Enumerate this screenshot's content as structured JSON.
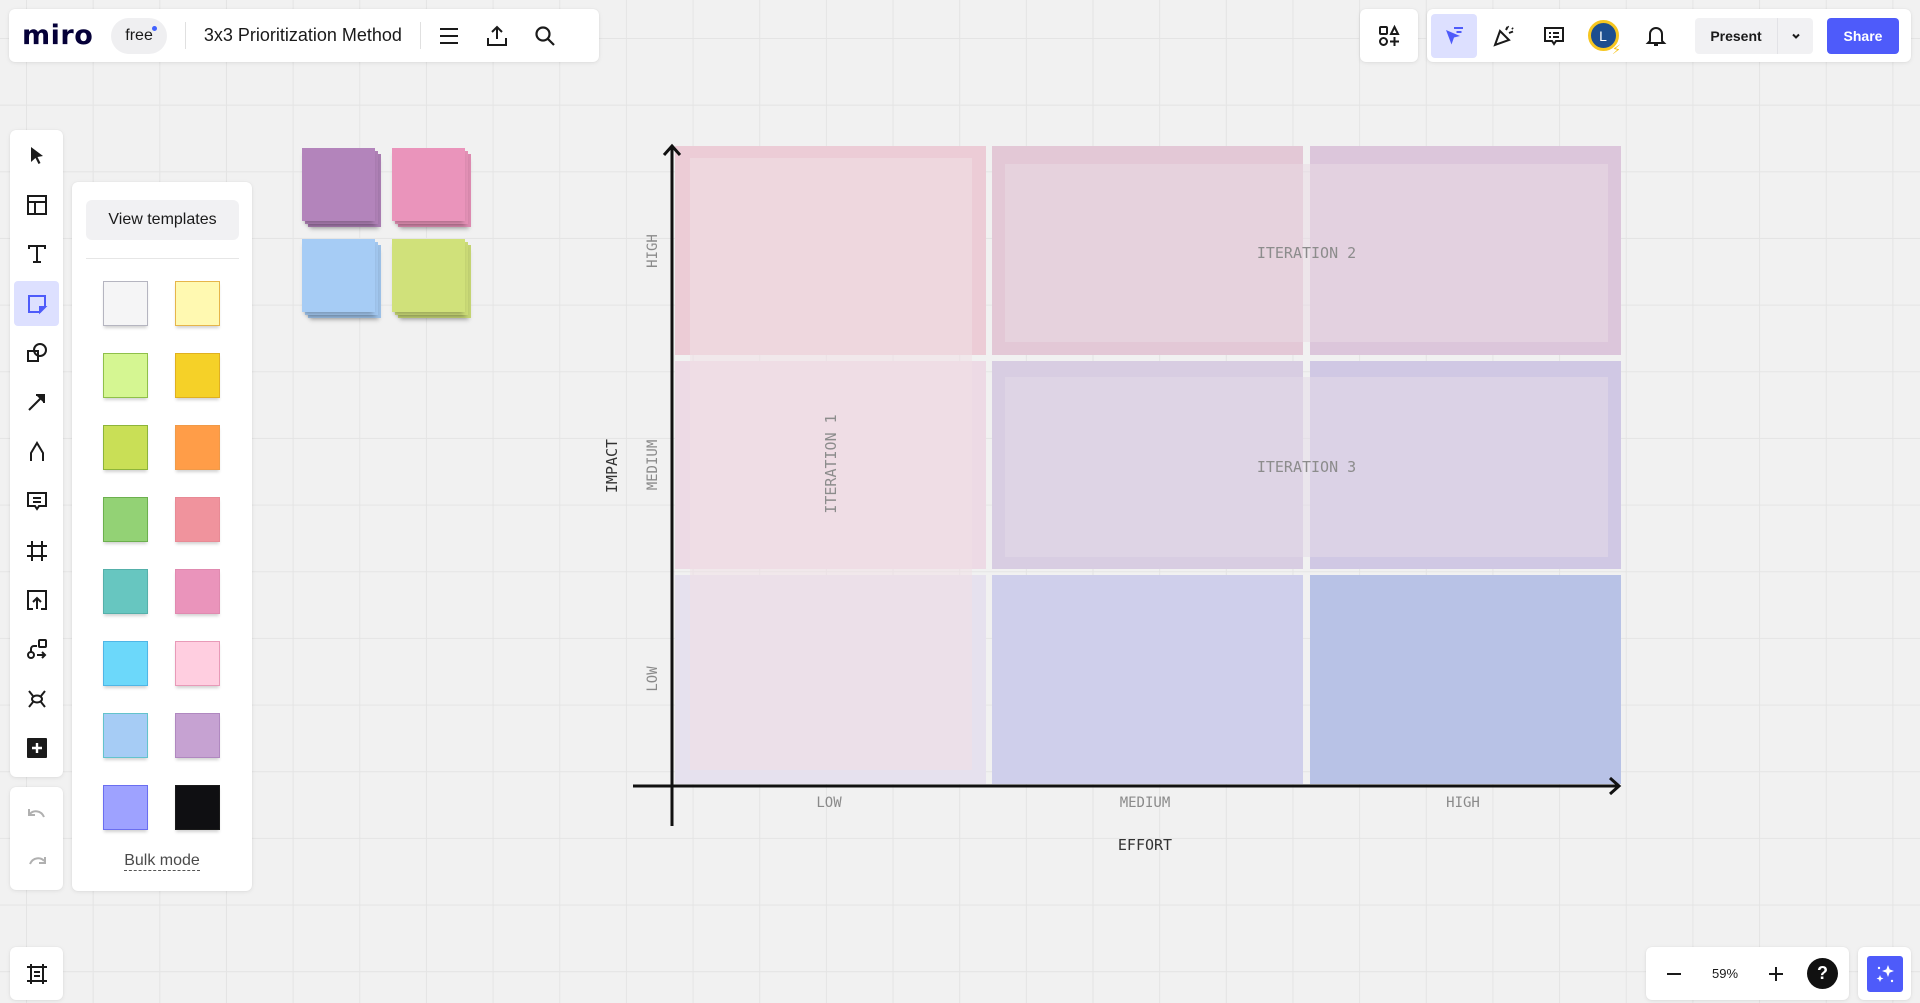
{
  "app": {
    "logo": "miro",
    "plan_badge": "free",
    "board_title": "3x3 Prioritization Method"
  },
  "top_bar_icons": [
    "menu-icon",
    "export-icon",
    "search-icon"
  ],
  "collab_bar": {
    "icons": [
      "apps-icon",
      "follow-cursor-icon",
      "celebrate-icon",
      "comments-icon",
      "avatar",
      "notifications-icon"
    ],
    "avatar_initial": "L",
    "present_label": "Present",
    "share_label": "Share",
    "accent_color": "#4e5bfa"
  },
  "left_toolbar": {
    "tools": [
      {
        "name": "select",
        "icon": "cursor-icon",
        "active": false
      },
      {
        "name": "templates",
        "icon": "layout-icon",
        "active": false
      },
      {
        "name": "text",
        "icon": "text-icon",
        "active": false
      },
      {
        "name": "sticky-note",
        "icon": "sticky-note-icon",
        "active": true
      },
      {
        "name": "shapes",
        "icon": "shapes-icon",
        "active": false
      },
      {
        "name": "connection-line",
        "icon": "arrow-icon",
        "active": false
      },
      {
        "name": "pen",
        "icon": "pen-icon",
        "active": false
      },
      {
        "name": "comment",
        "icon": "comment-icon",
        "active": false
      },
      {
        "name": "frame",
        "icon": "frame-icon",
        "active": false
      },
      {
        "name": "upload",
        "icon": "upload-icon",
        "active": false
      },
      {
        "name": "diagram",
        "icon": "diagram-icon",
        "active": false
      },
      {
        "name": "mind-map",
        "icon": "mindmap-icon",
        "active": false
      },
      {
        "name": "more-apps",
        "icon": "plus-square-icon",
        "active": false
      }
    ],
    "undo_icon": "undo-icon",
    "redo_icon": "redo-icon",
    "frames_icon": "frames-list-icon"
  },
  "sticky_panel": {
    "view_templates_label": "View templates",
    "bulk_mode_label": "Bulk mode",
    "swatches": [
      {
        "color": "#f5f5f6",
        "border": "#b5b5c0"
      },
      {
        "color": "#fff9b1",
        "border": "#e6b54a"
      },
      {
        "color": "#d5f692",
        "border": "#8fc04a"
      },
      {
        "color": "#f5d128",
        "border": "#e0b020"
      },
      {
        "color": "#c9df56",
        "border": "#8db43a"
      },
      {
        "color": "#ff9d48",
        "border": "#f09a48"
      },
      {
        "color": "#93d275",
        "border": "#6cb04e"
      },
      {
        "color": "#f0939d",
        "border": "#e88a95"
      },
      {
        "color": "#67c6c0",
        "border": "#55b0aa"
      },
      {
        "color": "#ea94bb",
        "border": "#e08ab0"
      },
      {
        "color": "#6cd8fa",
        "border": "#4fb6e6"
      },
      {
        "color": "#ffcee0",
        "border": "#e89ab8"
      },
      {
        "color": "#a6ccf5",
        "border": "#63c3cc"
      },
      {
        "color": "#c6a2d2",
        "border": "#b088c0"
      },
      {
        "color": "#9ea2ff",
        "border": "#6a6ef0"
      },
      {
        "color": "#0f0f12",
        "border": "#1a1a1a"
      }
    ]
  },
  "canvas_stickies": [
    {
      "color": "#b384bb"
    },
    {
      "color": "#ea94bb"
    },
    {
      "color": "#a6ccf5"
    },
    {
      "color": "#d0e17a"
    }
  ],
  "matrix": {
    "y_axis_title": "IMPACT",
    "x_axis_title": "EFFORT",
    "y_levels": [
      "HIGH",
      "MEDIUM",
      "LOW"
    ],
    "x_levels": [
      "LOW",
      "MEDIUM",
      "HIGH"
    ],
    "cells": [
      {
        "impact": "HIGH",
        "effort": "LOW",
        "color": "#ecccd6"
      },
      {
        "impact": "HIGH",
        "effort": "MEDIUM",
        "color": "#e3c8d6"
      },
      {
        "impact": "HIGH",
        "effort": "HIGH",
        "color": "#dcc6db"
      },
      {
        "impact": "MEDIUM",
        "effort": "LOW",
        "color": "#eddae5"
      },
      {
        "impact": "MEDIUM",
        "effort": "MEDIUM",
        "color": "#d8cde2"
      },
      {
        "impact": "MEDIUM",
        "effort": "HIGH",
        "color": "#d0c8e4"
      },
      {
        "impact": "LOW",
        "effort": "LOW",
        "color": "#e6e1ee"
      },
      {
        "impact": "LOW",
        "effort": "MEDIUM",
        "color": "#cfcfeb"
      },
      {
        "impact": "LOW",
        "effort": "HIGH",
        "color": "#b8c2e6"
      }
    ],
    "iterations": [
      {
        "label": "ITERATION 1",
        "orientation": "vertical",
        "color": "#f1e0e6"
      },
      {
        "label": "ITERATION 2",
        "orientation": "horizontal",
        "color": "#eadbe4"
      },
      {
        "label": "ITERATION 3",
        "orientation": "horizontal",
        "color": "#e3dbe8"
      }
    ]
  },
  "zoom_controls": {
    "zoom_out_icon": "minus-icon",
    "zoom_level": "59%",
    "zoom_in_icon": "plus-icon",
    "help_label": "?",
    "ai_icon": "sparkles-icon"
  }
}
